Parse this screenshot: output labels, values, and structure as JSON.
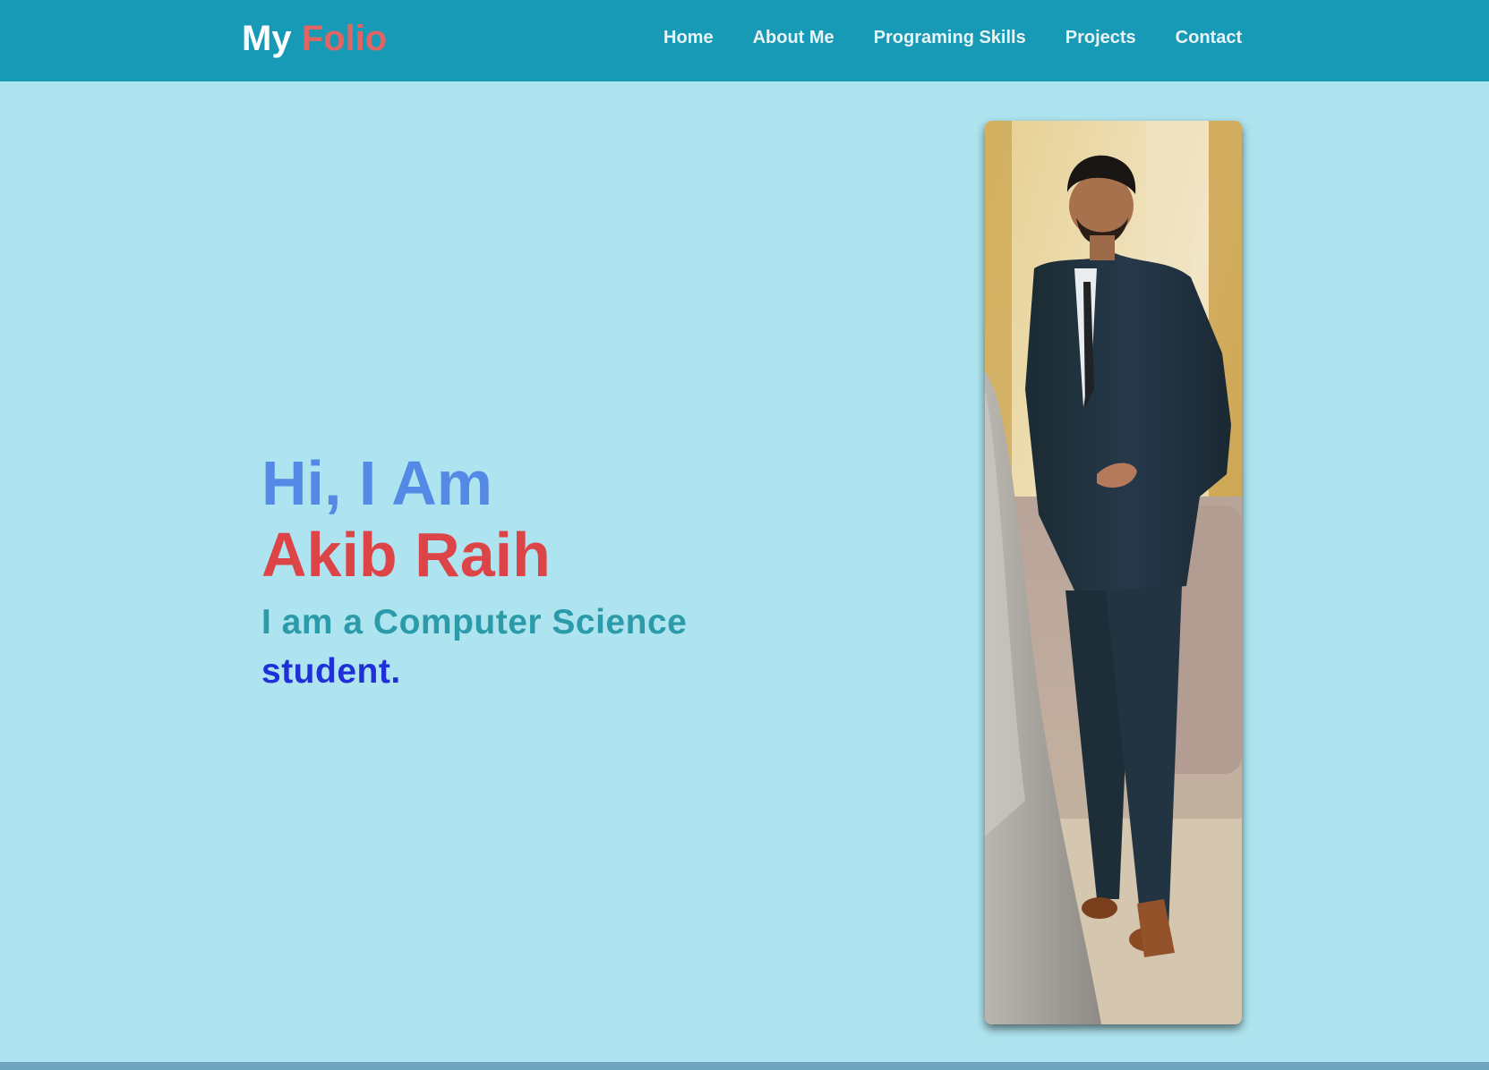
{
  "header": {
    "logo_my": "My",
    "logo_folio": "Folio",
    "nav": [
      {
        "label": "Home"
      },
      {
        "label": "About Me"
      },
      {
        "label": "Programing Skills"
      },
      {
        "label": "Projects"
      },
      {
        "label": "Contact"
      }
    ]
  },
  "hero": {
    "greeting": "Hi, I Am",
    "name": "Akib Raih",
    "tagline_part1": "I am a Computer Science",
    "tagline_part2": "student."
  },
  "colors": {
    "header_bg": "#169ab5",
    "page_bg": "#aee4ef",
    "logo_accent": "#e06666",
    "greeting": "#5489e6",
    "name": "#dc4448",
    "tagline_primary": "#2b9ba9",
    "tagline_secondary": "#1f31d6"
  }
}
